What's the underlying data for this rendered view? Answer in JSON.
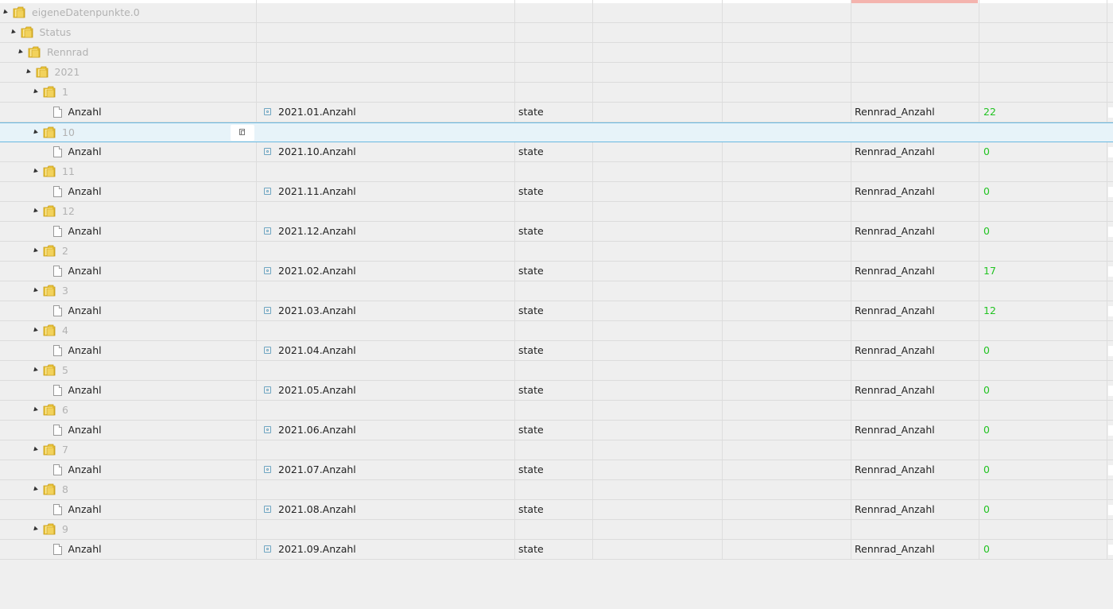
{
  "colors": {
    "value_green": "#22c322",
    "folder_label": "#b2b2b2",
    "selected_bg": "#e7f3f9",
    "selected_border": "#69b8df",
    "header_accent": "#f4b4ae"
  },
  "icons": {
    "folder": "folder-icon",
    "file": "file-icon",
    "state": "state-icon",
    "copy": "copy-icon",
    "expand": "expand-arrow-icon"
  },
  "rows": [
    {
      "type": "folder",
      "level": 0,
      "label": "eigeneDatenpunkte.0"
    },
    {
      "type": "folder",
      "level": 1,
      "label": "Status"
    },
    {
      "type": "folder",
      "level": 2,
      "label": "Rennrad"
    },
    {
      "type": "folder",
      "level": 3,
      "label": "2021"
    },
    {
      "type": "folder",
      "level": 4,
      "label": "1"
    },
    {
      "type": "state",
      "level": 5,
      "label": "Anzahl",
      "name": "2021.01.Anzahl",
      "kind": "state",
      "role": "Rennrad_Anzahl",
      "value": "22"
    },
    {
      "type": "folder",
      "level": 4,
      "label": "10",
      "selected": true
    },
    {
      "type": "state",
      "level": 5,
      "label": "Anzahl",
      "name": "2021.10.Anzahl",
      "kind": "state",
      "role": "Rennrad_Anzahl",
      "value": "0"
    },
    {
      "type": "folder",
      "level": 4,
      "label": "11"
    },
    {
      "type": "state",
      "level": 5,
      "label": "Anzahl",
      "name": "2021.11.Anzahl",
      "kind": "state",
      "role": "Rennrad_Anzahl",
      "value": "0"
    },
    {
      "type": "folder",
      "level": 4,
      "label": "12"
    },
    {
      "type": "state",
      "level": 5,
      "label": "Anzahl",
      "name": "2021.12.Anzahl",
      "kind": "state",
      "role": "Rennrad_Anzahl",
      "value": "0"
    },
    {
      "type": "folder",
      "level": 4,
      "label": "2"
    },
    {
      "type": "state",
      "level": 5,
      "label": "Anzahl",
      "name": "2021.02.Anzahl",
      "kind": "state",
      "role": "Rennrad_Anzahl",
      "value": "17"
    },
    {
      "type": "folder",
      "level": 4,
      "label": "3"
    },
    {
      "type": "state",
      "level": 5,
      "label": "Anzahl",
      "name": "2021.03.Anzahl",
      "kind": "state",
      "role": "Rennrad_Anzahl",
      "value": "12"
    },
    {
      "type": "folder",
      "level": 4,
      "label": "4"
    },
    {
      "type": "state",
      "level": 5,
      "label": "Anzahl",
      "name": "2021.04.Anzahl",
      "kind": "state",
      "role": "Rennrad_Anzahl",
      "value": "0"
    },
    {
      "type": "folder",
      "level": 4,
      "label": "5"
    },
    {
      "type": "state",
      "level": 5,
      "label": "Anzahl",
      "name": "2021.05.Anzahl",
      "kind": "state",
      "role": "Rennrad_Anzahl",
      "value": "0"
    },
    {
      "type": "folder",
      "level": 4,
      "label": "6"
    },
    {
      "type": "state",
      "level": 5,
      "label": "Anzahl",
      "name": "2021.06.Anzahl",
      "kind": "state",
      "role": "Rennrad_Anzahl",
      "value": "0"
    },
    {
      "type": "folder",
      "level": 4,
      "label": "7"
    },
    {
      "type": "state",
      "level": 5,
      "label": "Anzahl",
      "name": "2021.07.Anzahl",
      "kind": "state",
      "role": "Rennrad_Anzahl",
      "value": "0"
    },
    {
      "type": "folder",
      "level": 4,
      "label": "8"
    },
    {
      "type": "state",
      "level": 5,
      "label": "Anzahl",
      "name": "2021.08.Anzahl",
      "kind": "state",
      "role": "Rennrad_Anzahl",
      "value": "0"
    },
    {
      "type": "folder",
      "level": 4,
      "label": "9"
    },
    {
      "type": "state",
      "level": 5,
      "label": "Anzahl",
      "name": "2021.09.Anzahl",
      "kind": "state",
      "role": "Rennrad_Anzahl",
      "value": "0"
    }
  ]
}
